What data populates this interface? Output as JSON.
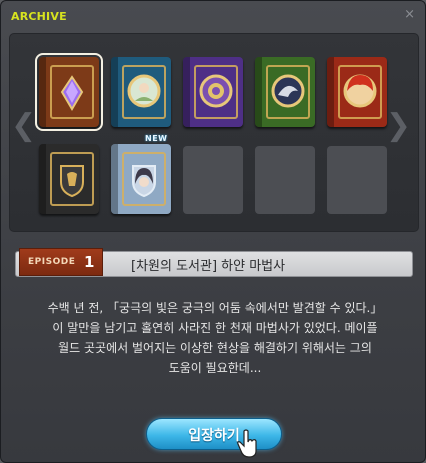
{
  "window": {
    "title": "ARCHIVE",
    "close": "×"
  },
  "nav": {
    "prev": "❮",
    "next": "❯"
  },
  "books": [
    {
      "icon": "crystal-icon",
      "color": "#7d3a18",
      "selected": true
    },
    {
      "icon": "elf-portrait-icon",
      "color": "#1f5b7d"
    },
    {
      "icon": "lion-emblem-icon",
      "color": "#4e2f86"
    },
    {
      "icon": "dragon-crest-icon",
      "color": "#3a6b25"
    },
    {
      "icon": "red-hair-portrait-icon",
      "color": "#9b2a17"
    },
    {
      "icon": "lion-shield-icon",
      "color": "#2b2b2b"
    },
    {
      "icon": "white-mage-portrait-icon",
      "color": "#8fa9c4",
      "badge": "NEW"
    }
  ],
  "episode": {
    "label": "EPISODE",
    "number": "1",
    "title": "[차원의 도서관] 하얀 마법사"
  },
  "description": [
    "수백 년 전, 「궁극의 빛은 궁극의 어둠 속에서만 발견할 수 있다.」",
    "이 말만을 남기고 홀연히 사라진 한 천재 마법사가 있었다. 메이플",
    "월드 곳곳에서 벌어지는 이상한 현상을 해결하기 위해서는 그의",
    "도움이 필요한데..."
  ],
  "enter_button": {
    "label": "입장하기"
  },
  "colors": {
    "title": "#d7e31f",
    "episode_badge": "#a03b1b",
    "button": "#3db7e8"
  }
}
